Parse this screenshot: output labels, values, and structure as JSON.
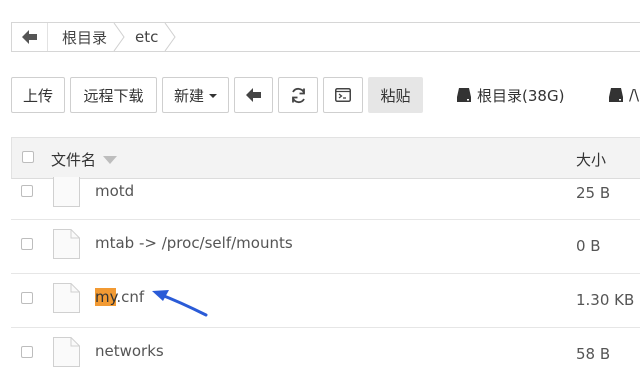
{
  "breadcrumb": {
    "back_icon": "arrow-left-icon",
    "items": [
      "根目录",
      "etc"
    ]
  },
  "toolbar": {
    "upload_label": "上传",
    "remote_download_label": "远程下载",
    "new_label": "新建",
    "back_icon": "arrow-left-icon",
    "refresh_icon": "refresh-icon",
    "terminal_icon": "terminal-icon",
    "paste_label": "粘贴"
  },
  "disks": [
    {
      "icon": "hard-drive-icon",
      "label": "根目录(38G)"
    },
    {
      "icon": "hard-drive-icon",
      "label": "/\\"
    }
  ],
  "table": {
    "col_name": "文件名",
    "col_size": "大小",
    "rows": [
      {
        "name": "motd",
        "size": "25 B"
      },
      {
        "name": "mtab -> /proc/self/mounts",
        "size": "0 B"
      },
      {
        "name_highlight": "my",
        "name_rest": ".cnf",
        "size": "1.30 KB"
      },
      {
        "name": "networks",
        "size": "58 B"
      }
    ]
  },
  "colors": {
    "highlight": "#f29a33",
    "annotation_arrow": "#2a5bd7"
  }
}
